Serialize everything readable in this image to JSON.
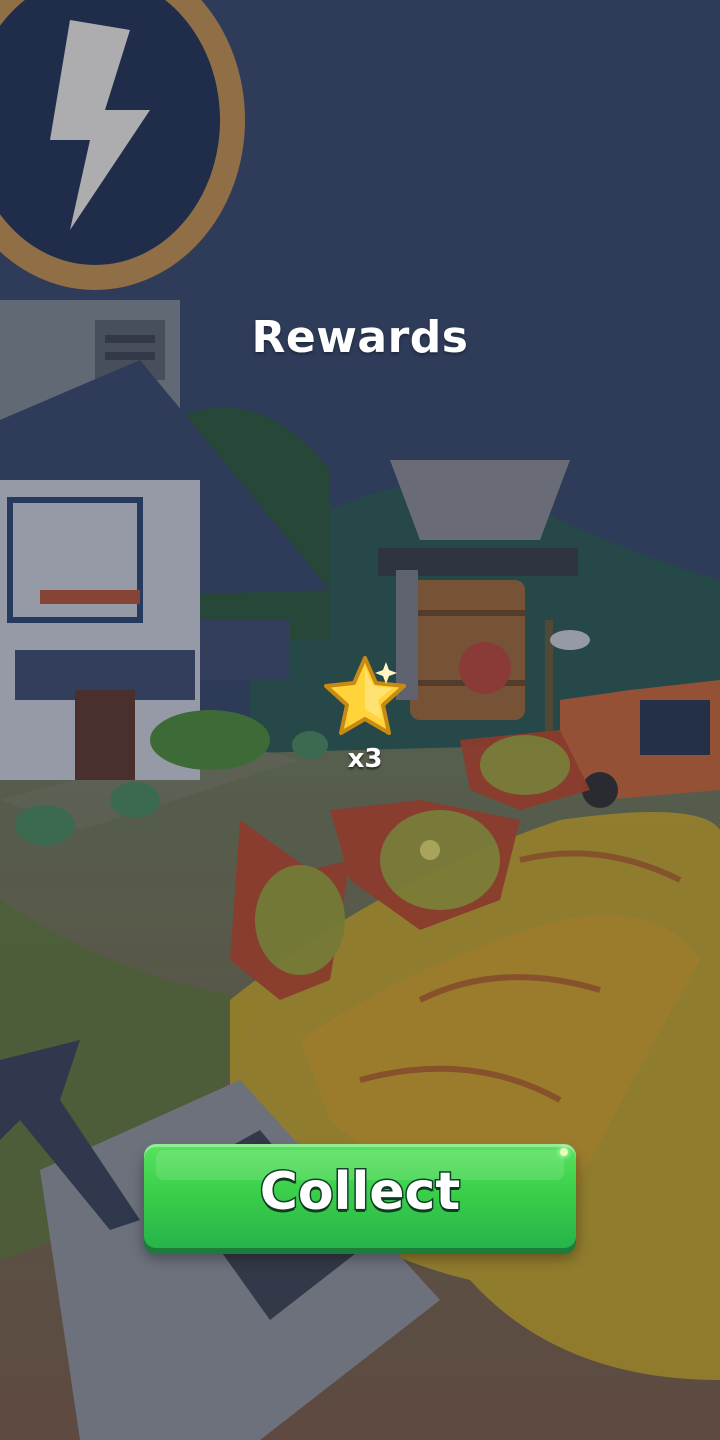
{
  "screen": {
    "title": "Rewards"
  },
  "reward": {
    "icon": "star-icon",
    "count_label": "x3",
    "color": "#ffd43b"
  },
  "collect_button": {
    "label": "Collect",
    "color": "#3bd04a"
  }
}
